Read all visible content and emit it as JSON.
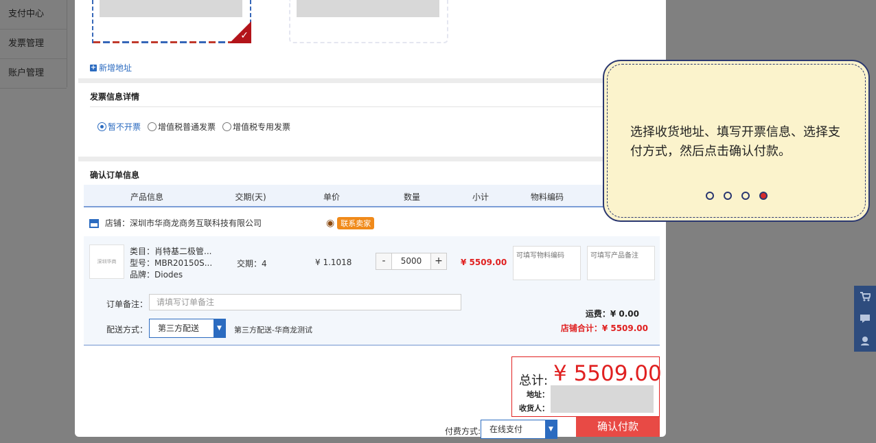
{
  "sidebar": {
    "items": [
      {
        "label": "支付中心"
      },
      {
        "label": "发票管理"
      },
      {
        "label": "账户管理"
      }
    ]
  },
  "address": {
    "add_label": "新增地址",
    "check_mark": "✓"
  },
  "invoice": {
    "title": "发票信息详情",
    "options": [
      {
        "label": "暂不开票",
        "selected": true
      },
      {
        "label": "增值税普通发票",
        "selected": false
      },
      {
        "label": "增值税专用发票",
        "selected": false
      }
    ]
  },
  "order": {
    "title": "确认订单信息",
    "columns": [
      "产品信息",
      "交期(天)",
      "单价",
      "数量",
      "小计",
      "物料编码"
    ],
    "shop": {
      "label": "店铺：深圳市华商龙商务互联科技有限公司",
      "contact": "联系卖家"
    },
    "item": {
      "thumb_text": "深圳华商",
      "category": "类目：肖特基二极管...",
      "model": "型号：MBR20150S...",
      "brand": "品牌：Diodes",
      "lead_time": "交期：4",
      "unit_price": "¥ 1.1018",
      "quantity": "5000",
      "minus": "-",
      "plus": "+",
      "subtotal": "¥ 5509.00",
      "material_placeholder": "可填写物料编码",
      "remark_placeholder": "可填写产品备注"
    },
    "remark_label": "订单备注：",
    "remark_placeholder": "请填写订单备注",
    "ship_label": "配送方式：",
    "ship_value": "第三方配送",
    "ship_desc": "第三方配送-华商龙测试",
    "freight": "运费：¥ 0.00",
    "shop_total": "店铺合计：¥ 5509.00"
  },
  "summary": {
    "total_label": "总计:",
    "total_value": "¥  5509.00",
    "address_label": "地址：",
    "receiver_label": "收货人："
  },
  "payment": {
    "label": "付费方式:",
    "value": "在线支付",
    "confirm": "确认付款"
  },
  "tooltip": {
    "text": "选择收货地址、填写开票信息、选择支付方式，然后点击确认付款。",
    "step": 4,
    "total_steps": 4
  },
  "colors": {
    "accent": "#2b6bc0",
    "price": "#e02020",
    "confirm_bg": "#e84a45",
    "tooltip_bg": "#fbf3cc",
    "tooltip_border": "#2a3770"
  },
  "float_bar": {
    "icons": [
      "cart-icon",
      "chat-icon",
      "service-icon"
    ]
  }
}
